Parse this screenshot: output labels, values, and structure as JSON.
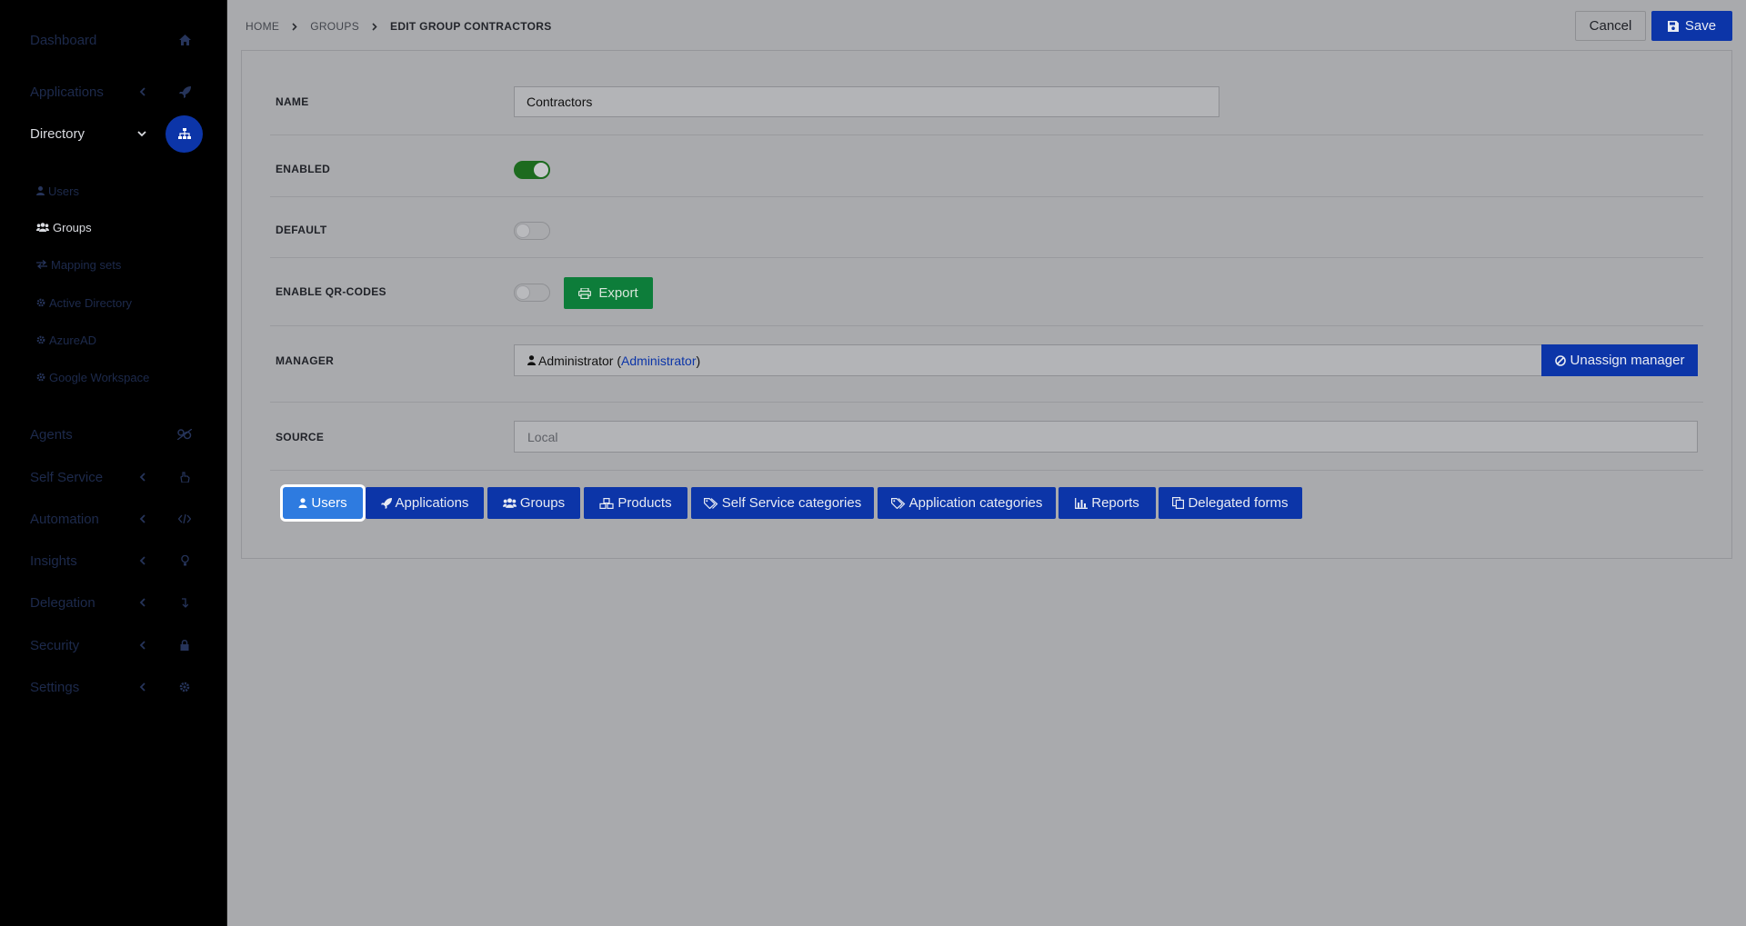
{
  "sidebar": {
    "items": [
      {
        "label": "Dashboard",
        "icon": "home-icon"
      },
      {
        "label": "Applications",
        "icon": "rocket-icon"
      },
      {
        "label": "Directory",
        "icon": "sitemap-icon"
      },
      {
        "label": "Agents",
        "icon": "agents-icon"
      },
      {
        "label": "Self Service",
        "icon": "hand-icon"
      },
      {
        "label": "Automation",
        "icon": "code-icon"
      },
      {
        "label": "Insights",
        "icon": "lightbulb-icon"
      },
      {
        "label": "Delegation",
        "icon": "delegation-icon"
      },
      {
        "label": "Security",
        "icon": "lock-icon"
      },
      {
        "label": "Settings",
        "icon": "gear-icon"
      }
    ],
    "directory_sub": [
      {
        "label": "Users",
        "icon": "user-icon"
      },
      {
        "label": "Groups",
        "icon": "users-icon"
      },
      {
        "label": "Mapping sets",
        "icon": "exchange-icon"
      },
      {
        "label": "Active Directory",
        "icon": "gear-icon"
      },
      {
        "label": "AzureAD",
        "icon": "gear-icon"
      },
      {
        "label": "Google Workspace",
        "icon": "gear-icon"
      }
    ]
  },
  "breadcrumb": {
    "home": "HOME",
    "groups": "GROUPS",
    "current": "EDIT GROUP CONTRACTORS"
  },
  "header": {
    "cancel_label": "Cancel",
    "save_label": "Save"
  },
  "form": {
    "name_label": "NAME",
    "name_value": "Contractors",
    "enabled_label": "ENABLED",
    "enabled": true,
    "default_label": "DEFAULT",
    "default": false,
    "qr_label": "ENABLE QR-CODES",
    "qr_enabled": false,
    "export_label": "Export",
    "manager_label": "MANAGER",
    "manager_name": "Administrator (",
    "manager_link": "Administrator",
    "manager_close": ")",
    "unassign_label": "Unassign manager",
    "source_label": "SOURCE",
    "source_value": "Local"
  },
  "tabs": [
    {
      "label": "Users",
      "icon": "user-icon"
    },
    {
      "label": "Applications",
      "icon": "rocket-icon"
    },
    {
      "label": "Groups",
      "icon": "users-icon"
    },
    {
      "label": "Products",
      "icon": "cubes-icon"
    },
    {
      "label": "Self Service categories",
      "icon": "tags-icon"
    },
    {
      "label": "Application categories",
      "icon": "tags-icon"
    },
    {
      "label": "Reports",
      "icon": "bar-chart-icon"
    },
    {
      "label": "Delegated forms",
      "icon": "copy-icon"
    }
  ],
  "colors": {
    "primary": "#0c35a8",
    "active_tab": "#2e7be0",
    "export": "#0d7d3a",
    "toggle_on": "#1d6b1f"
  }
}
